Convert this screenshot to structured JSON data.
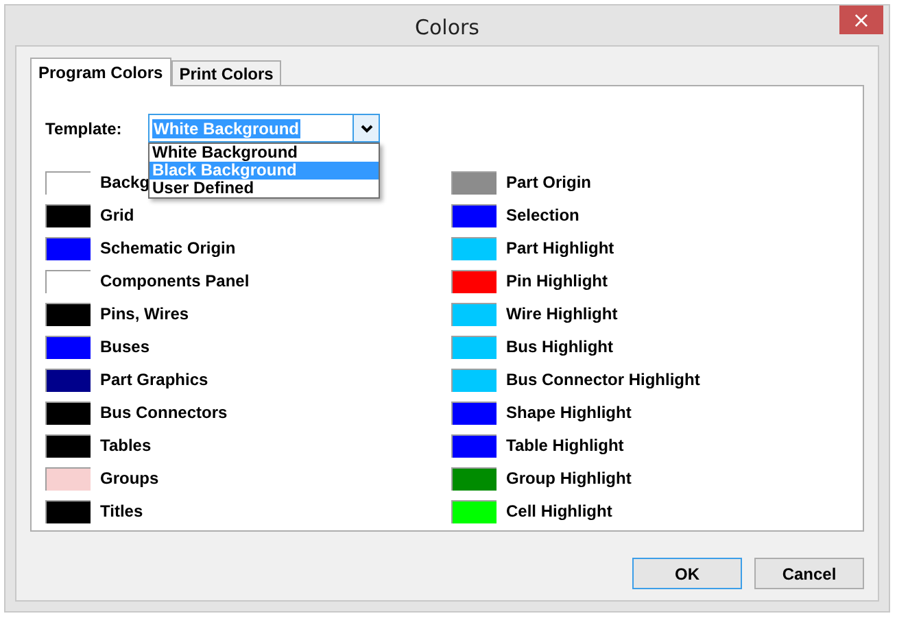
{
  "window": {
    "title": "Colors",
    "close": "×"
  },
  "tabs": [
    {
      "label": "Program Colors",
      "selected": true
    },
    {
      "label": "Print Colors",
      "selected": false
    }
  ],
  "template": {
    "label": "Template:",
    "value": "White Background",
    "expanded": true,
    "options": [
      {
        "label": "White Background",
        "highlighted": false
      },
      {
        "label": "Black Background",
        "highlighted": true
      },
      {
        "label": "User Defined",
        "highlighted": false
      }
    ]
  },
  "left_colors": [
    {
      "label": "Backg",
      "color": "#ffffff"
    },
    {
      "label": "Grid",
      "color": "#000000"
    },
    {
      "label": "Schematic Origin",
      "color": "#0000ff"
    },
    {
      "label": "Components Panel",
      "color": "#ffffff"
    },
    {
      "label": "Pins, Wires",
      "color": "#000000"
    },
    {
      "label": "Buses",
      "color": "#0000ff"
    },
    {
      "label": "Part Graphics",
      "color": "#00008b"
    },
    {
      "label": "Bus Connectors",
      "color": "#000000"
    },
    {
      "label": "Tables",
      "color": "#000000"
    },
    {
      "label": "Groups",
      "color": "#f8d0d0"
    },
    {
      "label": "Titles",
      "color": "#000000"
    }
  ],
  "right_colors": [
    {
      "label": "Part Origin",
      "color": "#8c8c8c"
    },
    {
      "label": "Selection",
      "color": "#0000ff"
    },
    {
      "label": "Part Highlight",
      "color": "#00c8ff"
    },
    {
      "label": "Pin Highlight",
      "color": "#ff0000"
    },
    {
      "label": "Wire Highlight",
      "color": "#00c8ff"
    },
    {
      "label": "Bus Highlight",
      "color": "#00c8ff"
    },
    {
      "label": "Bus Connector Highlight",
      "color": "#00c8ff"
    },
    {
      "label": "Shape Highlight",
      "color": "#0000ff"
    },
    {
      "label": "Table Highlight",
      "color": "#0000ff"
    },
    {
      "label": "Group Highlight",
      "color": "#008c00"
    },
    {
      "label": "Cell Highlight",
      "color": "#00ff00"
    }
  ],
  "buttons": [
    {
      "label": "OK",
      "default": true
    },
    {
      "label": "Cancel",
      "default": false
    }
  ]
}
